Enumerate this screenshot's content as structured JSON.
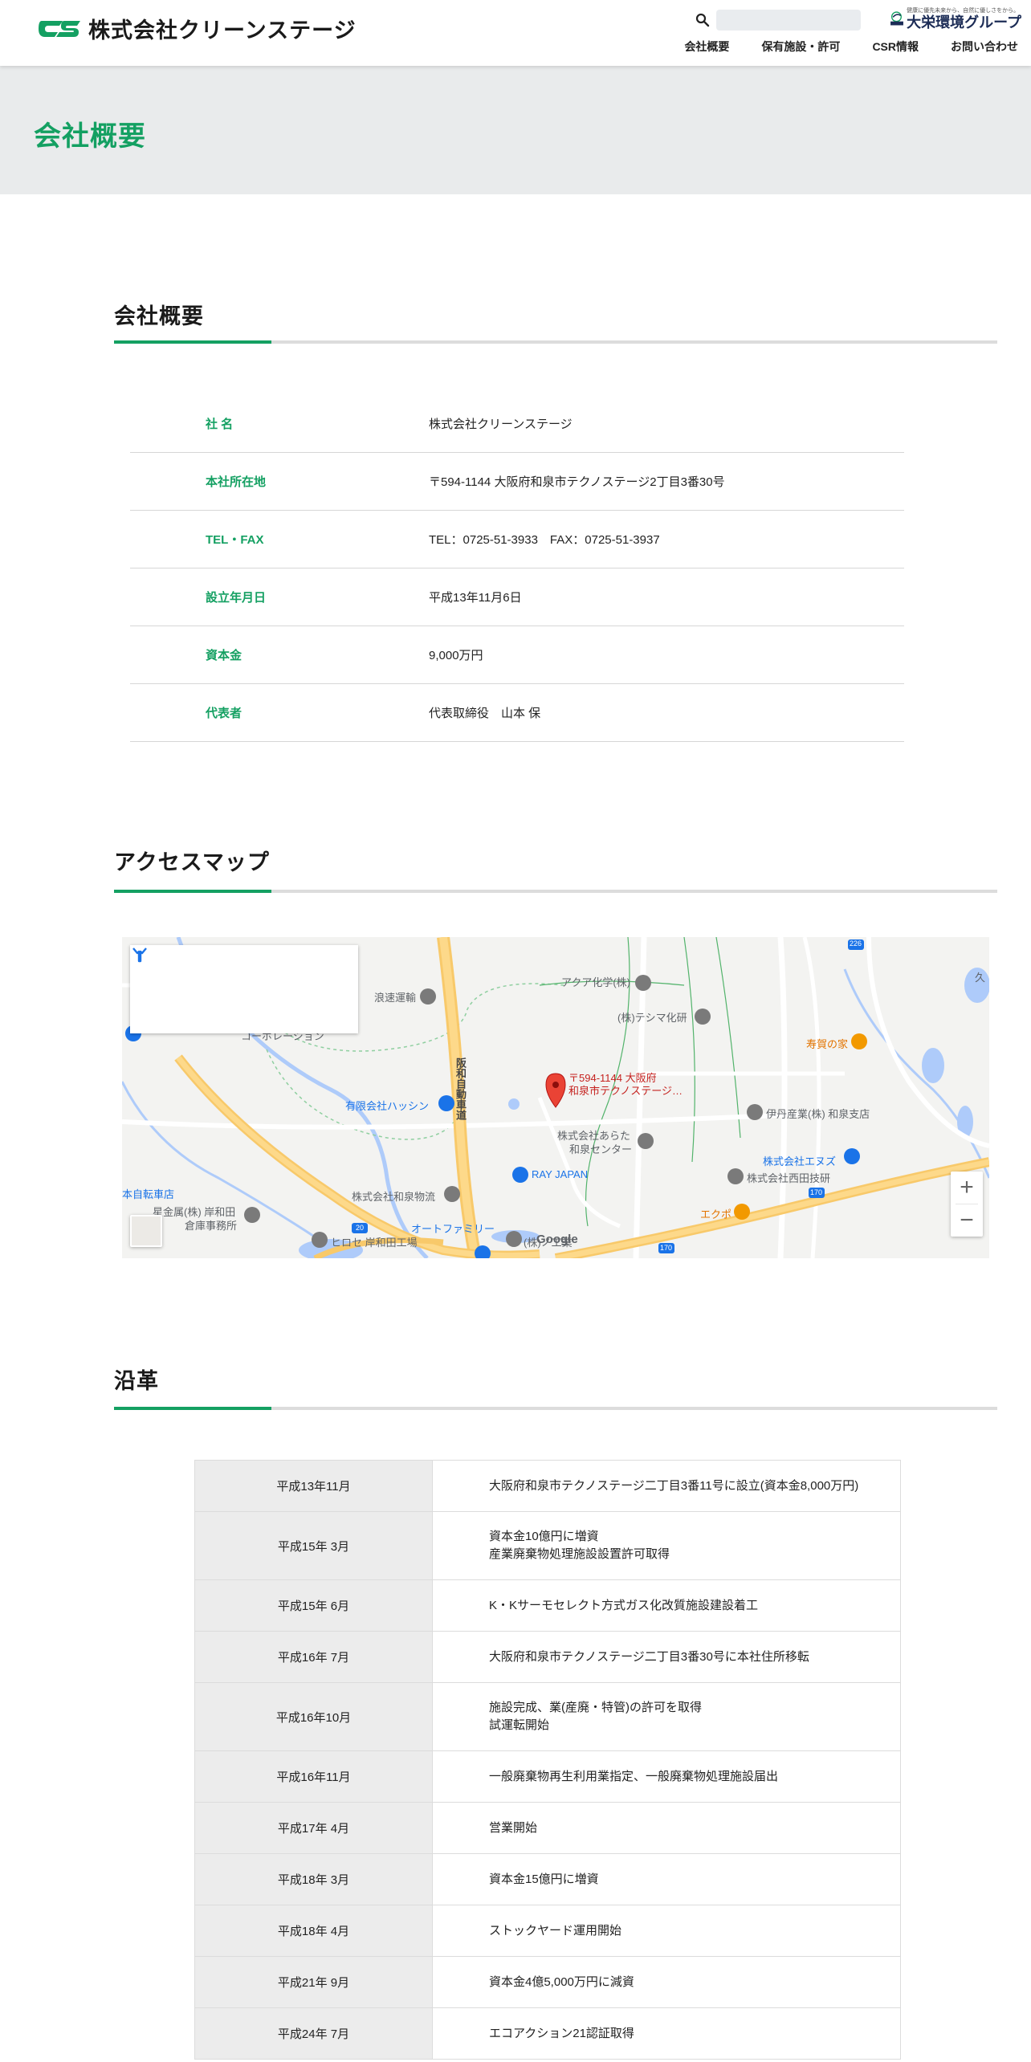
{
  "header": {
    "logo_mark": "CS",
    "logo_text": "株式会社クリーンステージ",
    "search_placeholder": "",
    "group_logo_tagline": "健康に優先未来から、自然に優しさをから。",
    "group_logo_mark": "DINS",
    "group_logo_name": "大栄環境グループ",
    "nav": [
      "会社概要",
      "保有施設・許可",
      "CSR情報",
      "お問い合わせ"
    ]
  },
  "page_title": "会社概要",
  "overview": {
    "heading": "会社概要",
    "rows": [
      {
        "label": "社 名",
        "value": "株式会社クリーンステージ"
      },
      {
        "label": "本社所在地",
        "value": "〒594-1144 大阪府和泉市テクノステージ2丁目3番30号"
      },
      {
        "label": "TEL・FAX",
        "value": "TEL：0725-51-3933　FAX：0725-51-3937"
      },
      {
        "label": "設立年月日",
        "value": "平成13年11月6日"
      },
      {
        "label": "資本金",
        "value": "9,000万円"
      },
      {
        "label": "代表者",
        "value": "代表取締役　山本 保"
      }
    ]
  },
  "access": {
    "heading": "アクセスマップ",
    "map": {
      "marker_label_line1": "〒594-1144 大阪府",
      "marker_label_line2": "和泉市テクノステージ…",
      "places": {
        "akua": "アクア化学(株)",
        "teshima": "(株)テシマ化研",
        "naniwa": "浪速運輸",
        "corporation": "コーポレーション",
        "hassin": "有限会社ハッシン",
        "hanwa": "阪和自動車道",
        "arata": "株式会社あらた",
        "arata2": "和泉センター",
        "itami": "伊丹産業(株) 和泉支店",
        "enuzu": "株式会社エヌズ",
        "nishida": "株式会社西田技研",
        "rayjapan": "RAY JAPAN",
        "butsuryu": "株式会社和泉物流",
        "otofamily": "オートファミリー",
        "jitensha": "本自転車店",
        "seikin": "星金属(株) 岸和田",
        "soko": "倉庫事務所",
        "hirose": "ヒロセ 岸和田工場",
        "kougyou": "(株)ノ工業",
        "jugaya": "寿賀の家",
        "ekopo": "エクポ",
        "hisa": "久",
        "rt226": "226",
        "rt20": "20",
        "rt170a": "170",
        "rt170b": "170"
      },
      "google": "Google",
      "zoom_in": "+",
      "zoom_out": "−"
    }
  },
  "history": {
    "heading": "沿革",
    "rows": [
      {
        "date": "平成13年11月",
        "lines": [
          "大阪府和泉市テクノステージ二丁目3番11号に設立(資本金8,000万円)"
        ]
      },
      {
        "date": "平成15年 3月",
        "lines": [
          "資本金10億円に増資",
          "産業廃棄物処理施設設置許可取得"
        ]
      },
      {
        "date": "平成15年 6月",
        "lines": [
          "K・Kサーモセレクト方式ガス化改質施設建設着工"
        ]
      },
      {
        "date": "平成16年 7月",
        "lines": [
          "大阪府和泉市テクノステージ二丁目3番30号に本社住所移転"
        ]
      },
      {
        "date": "平成16年10月",
        "lines": [
          "施設完成、業(産廃・特管)の許可を取得",
          "試運転開始"
        ]
      },
      {
        "date": "平成16年11月",
        "lines": [
          "一般廃棄物再生利用業指定、一般廃棄物処理施設届出"
        ]
      },
      {
        "date": "平成17年 4月",
        "lines": [
          "営業開始"
        ]
      },
      {
        "date": "平成18年 3月",
        "lines": [
          "資本金15億円に増資"
        ]
      },
      {
        "date": "平成18年 4月",
        "lines": [
          "ストックヤード運用開始"
        ]
      },
      {
        "date": "平成21年 9月",
        "lines": [
          "資本金4億5,000万円に減資"
        ]
      },
      {
        "date": "平成24年 7月",
        "lines": [
          "エコアクション21認証取得"
        ]
      }
    ]
  }
}
